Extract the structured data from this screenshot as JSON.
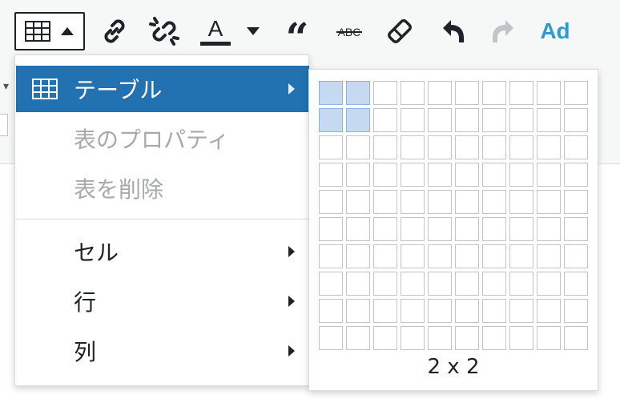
{
  "toolbar": {
    "buttons": [
      {
        "name": "table-button",
        "icon": "table-icon"
      },
      {
        "name": "insert-link-button",
        "icon": "link-icon"
      },
      {
        "name": "remove-link-button",
        "icon": "unlink-icon"
      },
      {
        "name": "text-color-button",
        "icon": "text-color-icon",
        "glyph": "A"
      },
      {
        "name": "blockquote-button",
        "icon": "quote-icon",
        "glyph": "“"
      },
      {
        "name": "strikethrough-button",
        "icon": "strikethrough-icon",
        "glyph": "ABC"
      },
      {
        "name": "clear-formatting-button",
        "icon": "eraser-icon"
      },
      {
        "name": "undo-button",
        "icon": "undo-icon"
      },
      {
        "name": "redo-button",
        "icon": "redo-icon"
      },
      {
        "name": "ad-button",
        "label": "Ad"
      }
    ],
    "accent_color": "#2e9ad4"
  },
  "menu": {
    "items": [
      {
        "label": "テーブル",
        "state": "active",
        "has_submenu": true,
        "icon": "table-icon"
      },
      {
        "label": "表のプロパティ",
        "state": "disabled",
        "has_submenu": false
      },
      {
        "label": "表を削除",
        "state": "disabled",
        "has_submenu": false
      },
      {
        "label": "セル",
        "state": "normal",
        "has_submenu": true
      },
      {
        "label": "行",
        "state": "normal",
        "has_submenu": true
      },
      {
        "label": "列",
        "state": "normal",
        "has_submenu": true
      }
    ],
    "active_color": "#2271b1"
  },
  "grid_picker": {
    "columns": 10,
    "rows": 10,
    "selected_columns": 2,
    "selected_rows": 2,
    "caption": "2 x 2",
    "selected_color": "#c5d9f1"
  }
}
